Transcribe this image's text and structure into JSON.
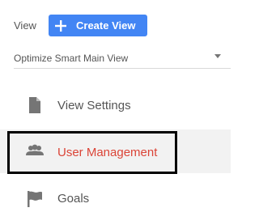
{
  "header": {
    "view_label": "View",
    "create_view_label": "Create View",
    "create_view_icon": "plus-icon"
  },
  "view_select": {
    "selected": "Optimize Smart Main View",
    "icon": "caret-down-icon"
  },
  "menu": {
    "items": [
      {
        "label": "View Settings",
        "icon": "document-icon",
        "active": false
      },
      {
        "label": "User Management",
        "icon": "users-icon",
        "active": true
      },
      {
        "label": "Goals",
        "icon": "flag-icon",
        "active": false
      }
    ]
  },
  "colors": {
    "accent": "#4285f4",
    "active_text": "#db4437",
    "text": "#555555",
    "icon": "#757575",
    "active_bg": "#f2f2f2",
    "highlight_border": "#000000"
  }
}
